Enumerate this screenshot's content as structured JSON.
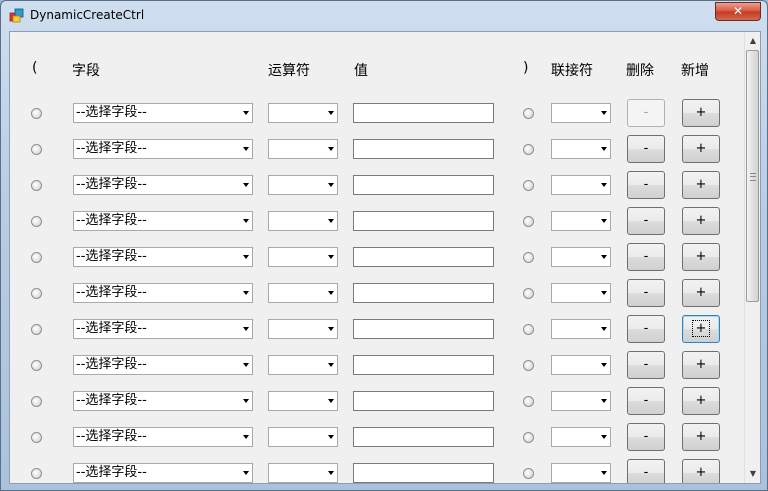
{
  "window": {
    "title": "DynamicCreateCtrl",
    "close_label": "✕"
  },
  "headers": {
    "open_paren": "(",
    "field": "字段",
    "operator": "运算符",
    "value": "值",
    "close_paren": ")",
    "connector": "联接符",
    "delete": "删除",
    "add": "新增"
  },
  "rows": [
    {
      "field": "--选择字段--",
      "delete_label": "-",
      "add_label": "+",
      "delete_enabled": false
    },
    {
      "field": "--选择字段--",
      "delete_label": "-",
      "add_label": "+",
      "delete_enabled": true
    },
    {
      "field": "--选择字段--",
      "delete_label": "-",
      "add_label": "+",
      "delete_enabled": true
    },
    {
      "field": "--选择字段--",
      "delete_label": "-",
      "add_label": "+",
      "delete_enabled": true
    },
    {
      "field": "--选择字段--",
      "delete_label": "-",
      "add_label": "+",
      "delete_enabled": true
    },
    {
      "field": "--选择字段--",
      "delete_label": "-",
      "add_label": "+",
      "delete_enabled": true
    },
    {
      "field": "--选择字段--",
      "delete_label": "-",
      "add_label": "+",
      "delete_enabled": true,
      "add_focused": true
    },
    {
      "field": "--选择字段--",
      "delete_label": "-",
      "add_label": "+",
      "delete_enabled": true
    },
    {
      "field": "--选择字段--",
      "delete_label": "-",
      "add_label": "+",
      "delete_enabled": true
    },
    {
      "field": "--选择字段--",
      "delete_label": "-",
      "add_label": "+",
      "delete_enabled": true
    },
    {
      "field": "--选择字段--",
      "delete_label": "-",
      "add_label": "+",
      "delete_enabled": true
    }
  ],
  "scrollbar": {
    "up_arrow": "▲",
    "down_arrow": "▼"
  }
}
